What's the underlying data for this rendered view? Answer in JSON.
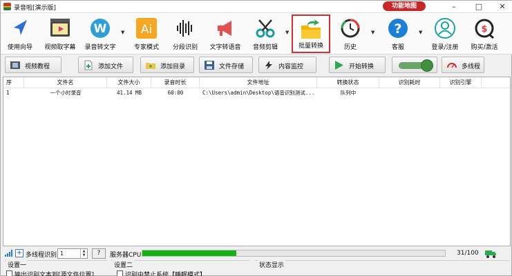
{
  "window": {
    "title": "录音啦[演示版]",
    "feature_map": "功能地图",
    "controls": [
      "–",
      "□",
      "✕"
    ]
  },
  "ribbon": {
    "tools": [
      {
        "label": "使用向导",
        "icon": "navigation-arrow-icon"
      },
      {
        "label": "视频取字幕",
        "icon": "video-play-icon"
      },
      {
        "label": "录音转文字",
        "icon": "w-speech-icon"
      },
      {
        "label": "专家模式",
        "icon": "ai-icon"
      },
      {
        "label": "分段识别",
        "icon": "waveform-icon"
      },
      {
        "label": "文字转语音",
        "icon": "megaphone-icon"
      },
      {
        "label": "音频剪辑",
        "icon": "scissors-icon"
      },
      {
        "label": "批量转换",
        "icon": "folder-arrow-icon"
      },
      {
        "label": "历史",
        "icon": "history-clock-icon"
      },
      {
        "label": "客服",
        "icon": "help-icon"
      },
      {
        "label": "登录/注册",
        "icon": "user-icon"
      },
      {
        "label": "购买/激活",
        "icon": "purchase-icon"
      }
    ]
  },
  "toolbar": {
    "video_tutorial": "视频教程",
    "add_file": "添加文件",
    "add_dir": "添加目录",
    "file_save": "文件存储",
    "content_monitor": "内容监控",
    "start_convert": "开始转换",
    "multithread": "多线程"
  },
  "table": {
    "columns": [
      "序",
      "文件名",
      "文件大小",
      "录音时长",
      "文件地址",
      "转换状态",
      "识别耗时",
      "识别引擎"
    ],
    "rows": [
      {
        "index": "1",
        "name": "一个小时录音",
        "size": "41.14 MB",
        "duration": "60:00",
        "path": "C:\\Users\\admin\\Desktop\\语音识别测试...",
        "status": "队列中",
        "elapsed": "",
        "engine": ""
      }
    ]
  },
  "statusbar": {
    "multithread_label": "多线程识别",
    "threads": "1",
    "help": "?",
    "server_cpu_label": "服务器CPU:",
    "cpu_progress": 0.31,
    "cpu_text": "31/100"
  },
  "bottom": {
    "group1_label": "设置一",
    "group1_option": "输出识别文本到[源文件位置]",
    "group2_label": "设置二",
    "group2_option": "识别中禁止系统【睡眠模式】",
    "status_label": "状态显示"
  },
  "colors": {
    "highlight": "#d32f2f",
    "progress": "#12b412",
    "feature_map": "#c62828"
  }
}
